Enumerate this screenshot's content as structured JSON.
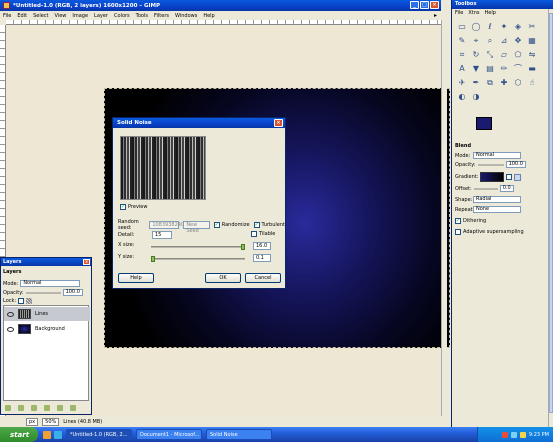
{
  "main_window": {
    "title": "*Untitled-1.0 (RGB, 2 layers) 1600x1200 – GIMP",
    "menu": [
      "File",
      "Edit",
      "Select",
      "View",
      "Image",
      "Layer",
      "Colors",
      "Tools",
      "Filters",
      "Windows",
      "Help"
    ],
    "status": {
      "unit": "px",
      "zoom": "50%",
      "info": "Lines (40.8 MB)"
    }
  },
  "layers_dock": {
    "title": "Layers",
    "header": "Layers",
    "mode_label": "Mode:",
    "mode_value": "Normal",
    "opacity_label": "Opacity:",
    "opacity_value": "100.0",
    "lock_label": "Lock:",
    "layers": [
      {
        "name": "Lines"
      },
      {
        "name": "Background"
      }
    ]
  },
  "dialog": {
    "title": "Solid Noise",
    "preview_label": "Preview",
    "seed_label": "Random seed:",
    "seed_value": "1083938240",
    "new_seed_label": "New Seed",
    "randomize_label": "Randomize",
    "turbulent_label": "Turbulent",
    "detail_label": "Detail:",
    "detail_value": "15",
    "tileable_label": "Tilable",
    "xsize_label": "X size:",
    "xsize_value": "16.0",
    "ysize_label": "Y size:",
    "ysize_value": "0.1",
    "help_button": "Help",
    "ok_button": "OK",
    "cancel_button": "Cancel",
    "x_slider_fraction": 1.0,
    "y_slider_fraction": 0.0
  },
  "toolbox": {
    "title": "Toolbox",
    "menu": [
      "File",
      "Xtns",
      "Help"
    ],
    "tools": [
      "rect-select-icon",
      "ellipse-select-icon",
      "lasso-icon",
      "fuzzy-select-icon",
      "color-select-icon",
      "scissors-icon",
      "paths-icon",
      "color-picker-icon",
      "zoom-icon",
      "measure-icon",
      "move-icon",
      "align-icon",
      "crop-icon",
      "rotate-icon",
      "scale-icon",
      "shear-icon",
      "perspective-icon",
      "flip-icon",
      "text-icon",
      "bucket-fill-icon",
      "blend-icon",
      "pencil-icon",
      "paintbrush-icon",
      "eraser-icon",
      "airbrush-icon",
      "ink-icon",
      "clone-icon",
      "heal-icon",
      "perspective-clone-icon",
      "smudge-icon",
      "blur-icon",
      "dodge-icon"
    ],
    "panel_title": "Blend",
    "mode_label": "Mode:",
    "mode_value": "Normal",
    "opacity_label": "Opacity:",
    "opacity_value": "100.0",
    "gradient_label": "Gradient:",
    "offset_label": "Offset:",
    "offset_value": "0.0",
    "shape_label": "Shape:",
    "shape_value": "Radial",
    "repeat_label": "Repeat:",
    "repeat_value": "None",
    "dithering_label": "Dithering",
    "adaptive_label": "Adaptive supersampling"
  },
  "taskbar": {
    "start": "start",
    "tasks": [
      "*Untitled-1.0 (RGB, 2...",
      "Document1 - Microsof...",
      "Solid Noise"
    ],
    "clock": "9:23 PM"
  }
}
